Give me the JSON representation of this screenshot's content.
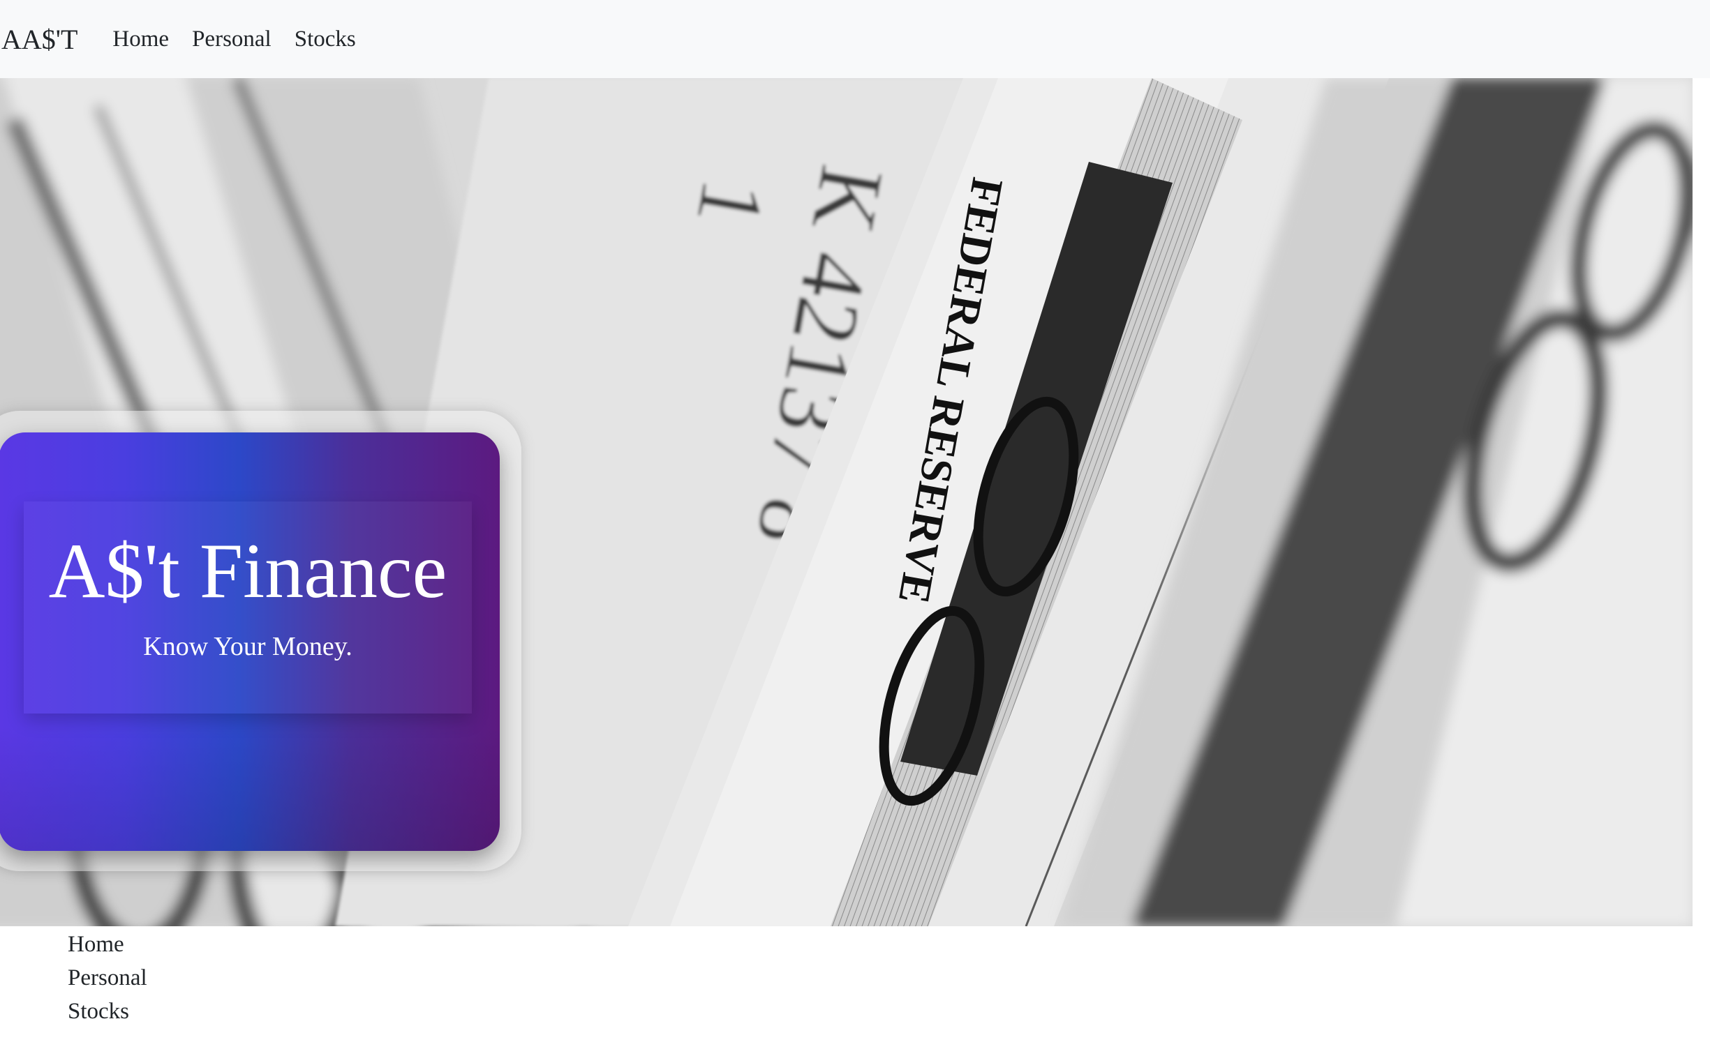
{
  "navbar": {
    "brand": "AA$'T",
    "links": [
      "Home",
      "Personal",
      "Stocks"
    ]
  },
  "hero": {
    "title": "A$'t Finance",
    "subtitle": "Know Your Money.",
    "background_icon": "banknotes-photo",
    "card_gradient": [
      "#5a38e4",
      "#2c48c8",
      "#5c1a80"
    ]
  },
  "footer": {
    "links": [
      "Home",
      "Personal",
      "Stocks"
    ]
  }
}
